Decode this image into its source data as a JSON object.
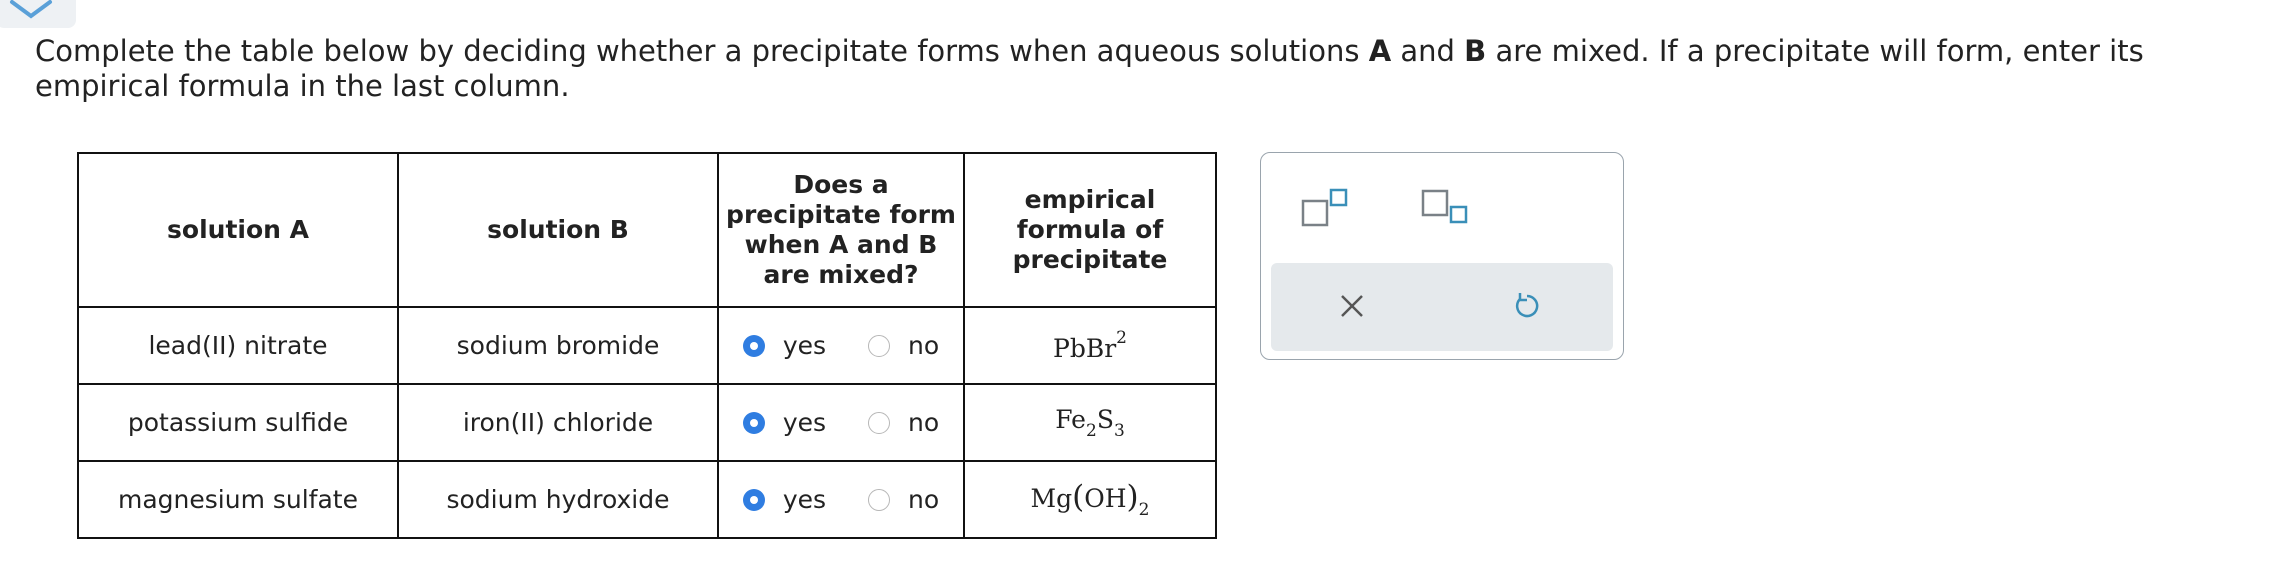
{
  "prompt": {
    "part1": "Complete the table below by deciding whether a precipitate forms when aqueous solutions ",
    "a": "A",
    "and": " and ",
    "b": "B",
    "part2": " are mixed. If a precipitate will form, enter its empirical formula in the last column."
  },
  "table": {
    "headers": {
      "solution_a": "solution A",
      "solution_b": "solution B",
      "precipitate": [
        "Does a",
        "precipitate form",
        "when A and B",
        "are mixed?"
      ],
      "formula": [
        "empirical",
        "formula of",
        "precipitate"
      ]
    },
    "rows": [
      {
        "solution_a": "lead(II) nitrate",
        "solution_b": "sodium bromide",
        "selected": "yes",
        "yes_label": "yes",
        "no_label": "no",
        "formula": {
          "el1": "Pb",
          "el2": "Br",
          "sup": "2"
        }
      },
      {
        "solution_a": "potassium sulfide",
        "solution_b": "iron(II) chloride",
        "selected": "yes",
        "yes_label": "yes",
        "no_label": "no",
        "formula": {
          "el1": "Fe",
          "sub1": "2",
          "el2": "S",
          "sub2": "3"
        }
      },
      {
        "solution_a": "magnesium sulfate",
        "solution_b": "sodium hydroxide",
        "selected": "yes",
        "yes_label": "yes",
        "no_label": "no",
        "formula": {
          "el1": "Mg",
          "group": "OH",
          "sub": "2"
        }
      }
    ]
  },
  "palette": {
    "icons": [
      "superscript-icon",
      "subscript-icon",
      "clear-icon",
      "undo-icon"
    ],
    "colors": {
      "accent": "#2f7de1",
      "box_teal": "#3a8fb8",
      "box_gray": "#7a8187",
      "toolbar_bg": "#e5e9ec"
    }
  }
}
